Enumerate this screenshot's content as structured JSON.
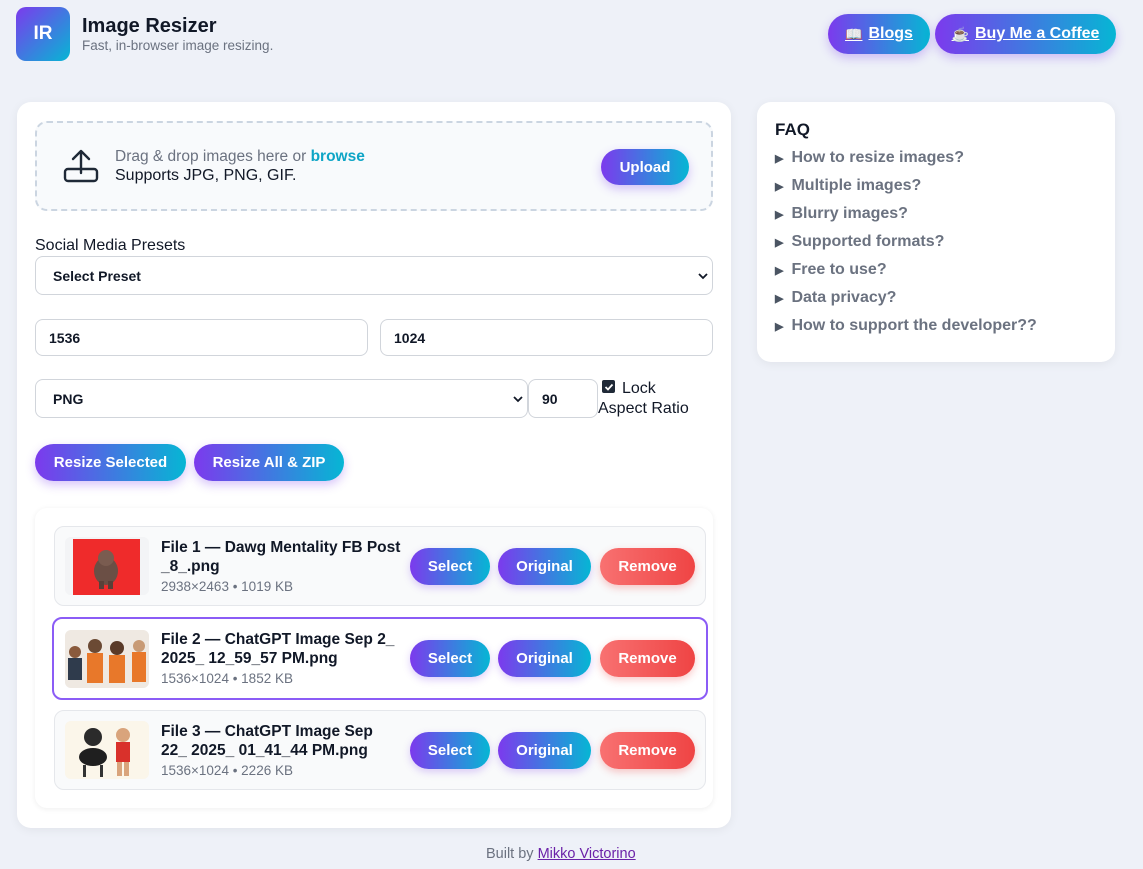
{
  "header": {
    "logo_text": "IR",
    "title": "Image Resizer",
    "subtitle": "Fast, in-browser image resizing.",
    "blogs_label": "Blogs",
    "coffee_label": "Buy Me a Coffee",
    "blogs_icon": "📖",
    "coffee_icon": "☕"
  },
  "upload": {
    "drag_text": "Drag & drop images here or ",
    "browse_text": "browse",
    "supports_text": "Supports JPG, PNG, GIF.",
    "upload_button": "Upload"
  },
  "presets": {
    "label": "Social Media Presets",
    "selected": "Select Preset"
  },
  "dimensions": {
    "width": "1536",
    "height": "1024"
  },
  "format": {
    "selected": "PNG",
    "quality": "90",
    "lock_label": "Lock Aspect Ratio",
    "lock_checked": true
  },
  "actions": {
    "resize_selected": "Resize Selected",
    "resize_all": "Resize All & ZIP"
  },
  "files": [
    {
      "name": "File 1 — Dawg Mentality FB Post _8_.png",
      "meta": "2938×2463 • 1019 KB",
      "selected": false
    },
    {
      "name": "File 2 — ChatGPT Image Sep 2_ 2025_ 12_59_57 PM.png",
      "meta": "1536×1024 • 1852 KB",
      "selected": true
    },
    {
      "name": "File 3 — ChatGPT Image Sep 22_ 2025_ 01_41_44 PM.png",
      "meta": "1536×1024 • 2226 KB",
      "selected": false
    }
  ],
  "file_buttons": {
    "select": "Select",
    "original": "Original",
    "remove": "Remove"
  },
  "faq": {
    "title": "FAQ",
    "items": [
      "How to resize images?",
      "Multiple images?",
      "Blurry images?",
      "Supported formats?",
      "Free to use?",
      "Data privacy?",
      "How to support the developer??"
    ]
  },
  "footer": {
    "built_by": "Built by ",
    "author": "Mikko Victorino"
  },
  "colors": {
    "accent_start": "#7c3aed",
    "accent_end": "#06b6d4",
    "remove": "#ef4444",
    "selected_border": "#8b5cf6"
  }
}
